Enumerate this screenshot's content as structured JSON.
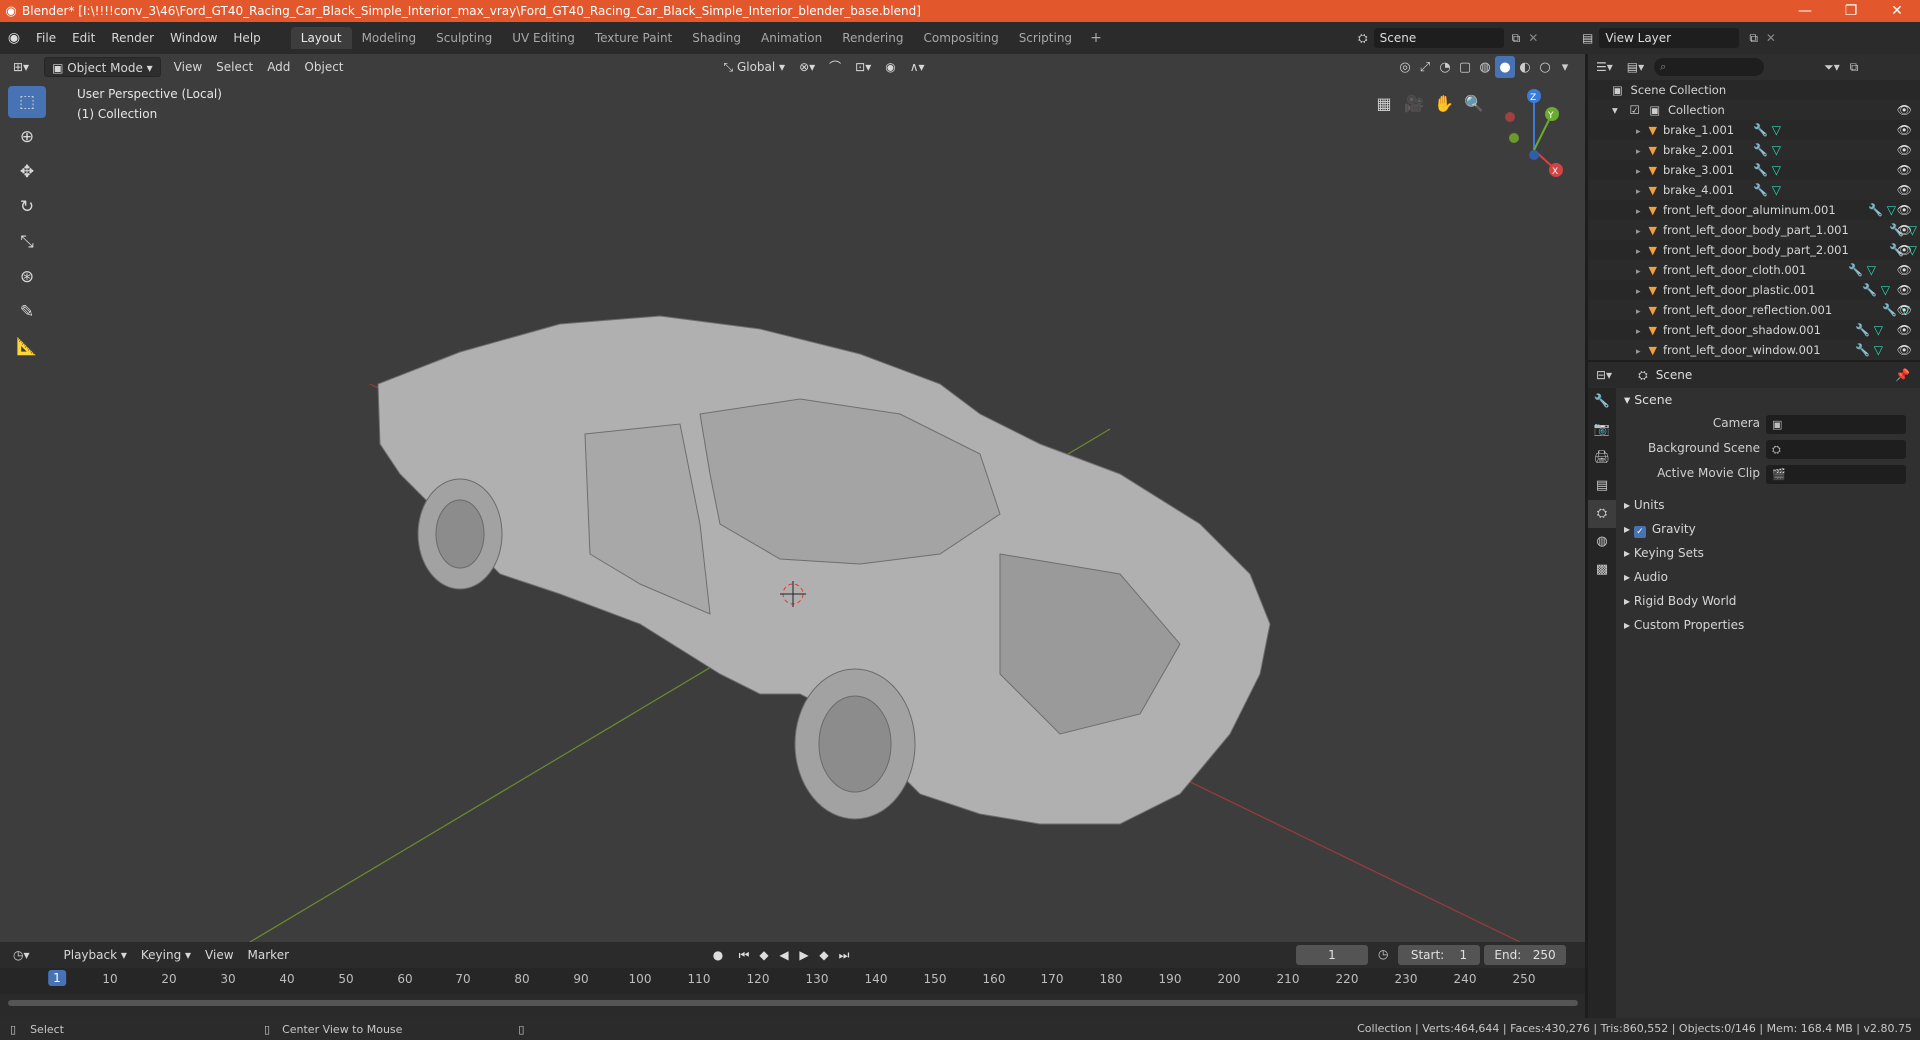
{
  "window": {
    "title": "Blender* [I:\\!!!!conv_3\\46\\Ford_GT40_Racing_Car_Black_Simple_Interior_max_vray\\Ford_GT40_Racing_Car_Black_Simple_Interior_blender_base.blend]"
  },
  "menu": [
    "File",
    "Edit",
    "Render",
    "Window",
    "Help"
  ],
  "workspaces": [
    "Layout",
    "Modeling",
    "Sculpting",
    "UV Editing",
    "Texture Paint",
    "Shading",
    "Animation",
    "Rendering",
    "Compositing",
    "Scripting"
  ],
  "scene_name": "Scene",
  "view_layer": "View Layer",
  "viewport": {
    "mode": "Object Mode",
    "menus": [
      "View",
      "Select",
      "Add",
      "Object"
    ],
    "transform_orientation": "Global",
    "info_line1": "User Perspective (Local)",
    "info_line2": "(1) Collection"
  },
  "outliner": {
    "root": "Scene Collection",
    "collection": "Collection",
    "items": [
      "brake_1.001",
      "brake_2.001",
      "brake_3.001",
      "brake_4.001",
      "front_left_door_aluminum.001",
      "front_left_door_body_part_1.001",
      "front_left_door_body_part_2.001",
      "front_left_door_cloth.001",
      "front_left_door_plastic.001",
      "front_left_door_reflection.001",
      "front_left_door_shadow.001",
      "front_left_door_window.001"
    ]
  },
  "properties": {
    "context": "Scene",
    "panel": "Scene",
    "camera_label": "Camera",
    "background_scene_label": "Background Scene",
    "active_clip_label": "Active Movie Clip",
    "subpanels": {
      "units": "Units",
      "gravity": "Gravity",
      "keying_sets": "Keying Sets",
      "audio": "Audio",
      "rigid_body": "Rigid Body World",
      "custom": "Custom Properties"
    }
  },
  "timeline": {
    "menus": [
      "Playback",
      "Keying",
      "View",
      "Marker"
    ],
    "current_frame": "1",
    "start_label": "Start:",
    "start": "1",
    "end_label": "End:",
    "end": "250",
    "ticks": [
      "1",
      "10",
      "20",
      "30",
      "40",
      "50",
      "60",
      "70",
      "80",
      "90",
      "100",
      "110",
      "120",
      "130",
      "140",
      "150",
      "160",
      "170",
      "180",
      "190",
      "200",
      "210",
      "220",
      "230",
      "240",
      "250"
    ]
  },
  "status": {
    "left_action": "Select",
    "mid_action": "Center View to Mouse",
    "stats": "Collection | Verts:464,644 | Faces:430,276 | Tris:860,552 | Objects:0/146 | Mem: 168.4 MB | v2.80.75"
  },
  "colors": {
    "titlebar": "#e2572b",
    "accent": "#4772b3",
    "viewport_bg": "#3d3d3d"
  }
}
